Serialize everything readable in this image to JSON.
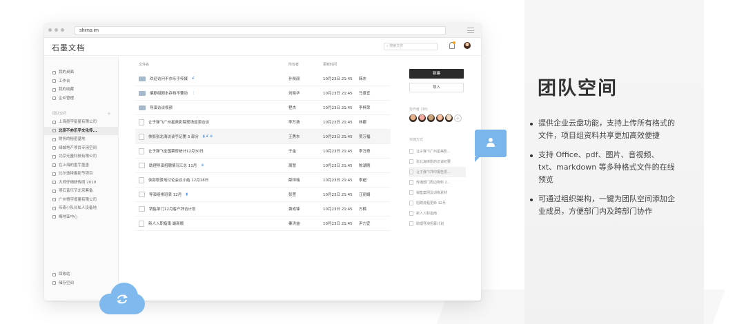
{
  "browser": {
    "url": "shimo.im"
  },
  "app": {
    "logo": "石墨文档",
    "search_placeholder": "搜索文件"
  },
  "sidebar": {
    "top_items": [
      {
        "label": "我的桌面",
        "icon": "desktop-icon"
      },
      {
        "label": "工作台",
        "icon": "workbench-icon"
      },
      {
        "label": "我的收藏",
        "icon": "star-icon"
      },
      {
        "label": "企业管理",
        "icon": "gear-icon"
      }
    ],
    "team_section_label": "团队空间",
    "team_add": "+",
    "team_items": [
      {
        "label": "上海墨宇星星有限公司"
      },
      {
        "label": "北京不亦乐乎文化传..."
      },
      {
        "label": "财务的秘密基地"
      },
      {
        "label": "绿城地产项目专用空间"
      },
      {
        "label": "北京无量科技有限公司"
      },
      {
        "label": "在上海的墨宇墨墨"
      },
      {
        "label": "比尔波特摄影节项目"
      },
      {
        "label": "大师仔细研传闻 2019"
      },
      {
        "label": "项石音乐节北京筹备"
      },
      {
        "label": "广州悟宇增量有限公司"
      },
      {
        "label": "传奇小队长私人设备地"
      },
      {
        "label": "梅地亚中心"
      }
    ],
    "active_index": 1,
    "bottom_items": [
      {
        "label": "回收站",
        "icon": "trash-icon"
      },
      {
        "label": "储存空间",
        "icon": "cloud-icon"
      }
    ]
  },
  "filelist": {
    "headers": {
      "name": "文件名",
      "owner": "所有者",
      "time": "更新时间",
      "updater": ""
    },
    "rows": [
      {
        "type": "folder",
        "name": "欢迎访问不亦乐乎传媒",
        "mark": "ꗃ",
        "owner": "孙晓丽",
        "time": "10月23日 21:45",
        "updater": "韩东"
      },
      {
        "type": "folder",
        "name": "编剧组剧本存档不要动",
        "mark": "⋮",
        "owner": "刘晓华",
        "time": "10月23日 21:45",
        "updater": "马景宜"
      },
      {
        "type": "folder",
        "name": "导演访谈视频",
        "mark": "",
        "owner": "程杰",
        "time": "10月23日 21:45",
        "updater": "李梓荣"
      },
      {
        "type": "doc",
        "name": "让子弹飞广州星美影院现场巡演访谈",
        "mark": "",
        "owner": "李万扬",
        "time": "10月23日 21:45",
        "updater": "林娜"
      },
      {
        "type": "doc",
        "name": "侠影张北海访谈手记第 3 部分",
        "mark": "▮ ꗃ ⊕",
        "owner": "王秀东",
        "time": "10月23日 21:45",
        "updater": "贾万福"
      },
      {
        "type": "doc",
        "name": "让子弹飞全国票房统计12月30日",
        "mark": "",
        "owner": "于金",
        "time": "10月23日 21:45",
        "updater": "李万奇"
      },
      {
        "type": "sheet",
        "name": "助理导演招聘情况汇总 11月",
        "mark": "⊕",
        "owner": "周慧",
        "time": "10月23日 21:45",
        "updater": "陈湖刚"
      },
      {
        "type": "doc",
        "name": "侠影取景地讨论会议小结 12月18日",
        "mark": "",
        "owner": "薛恒瑞",
        "time": "10月23日 21:45",
        "updater": "李超"
      },
      {
        "type": "sheet",
        "name": "导演组排班表 12月",
        "mark": "▮",
        "owner": "张萱",
        "time": "10月23日 21:45",
        "updater": "汪丽娟"
      },
      {
        "type": "sheet",
        "name": "销售部门12月客户拜访计划",
        "mark": "",
        "owner": "萧成锋",
        "time": "10月23日 21:45",
        "updater": "方楠"
      },
      {
        "type": "doc",
        "name": "新人入职指南 最新版",
        "mark": "",
        "owner": "秦洪益",
        "time": "10月23日 21:45",
        "updater": "尹力宜"
      }
    ],
    "highlight_index": 4
  },
  "rightpane": {
    "new_label": "新建",
    "import_label": "导入",
    "members_label": "协作者 (38)",
    "add_member": "+",
    "member_colors": [
      "#e9b18a",
      "#f1a9a0",
      "#c8a178",
      "#f6c0a0",
      "#f0d7c0"
    ],
    "quick_label": "快捷方式",
    "quick_items": [
      {
        "label": "让子弹飞广州星美影..."
      },
      {
        "label": "张北海侠影的访谈纪要"
      },
      {
        "label": "让子弹飞冲印报告票..."
      },
      {
        "label": "传播部门周边物料 2..."
      },
      {
        "label": "销售案例及训练素材"
      },
      {
        "label": "招聘流程更新 12月"
      },
      {
        "label": "新人入职指南"
      },
      {
        "label": "助理导演招募计划"
      }
    ],
    "quick_highlight_index": 2
  },
  "feature": {
    "title": "团队空间",
    "bullets": [
      "提供企业云盘功能，支持上传所有格式的文件，项目组资料共享更加高效便捷",
      "支持 Office、pdf、图片、音视频、txt、markdown 等多种格式文件的在线预览",
      "可通过组织架构，一键为团队空间添加企业成员，方便部门内及跨部门协作"
    ]
  },
  "colors": {
    "accent_blue": "#7fb9ee",
    "new_button": "#2c2c2c"
  }
}
